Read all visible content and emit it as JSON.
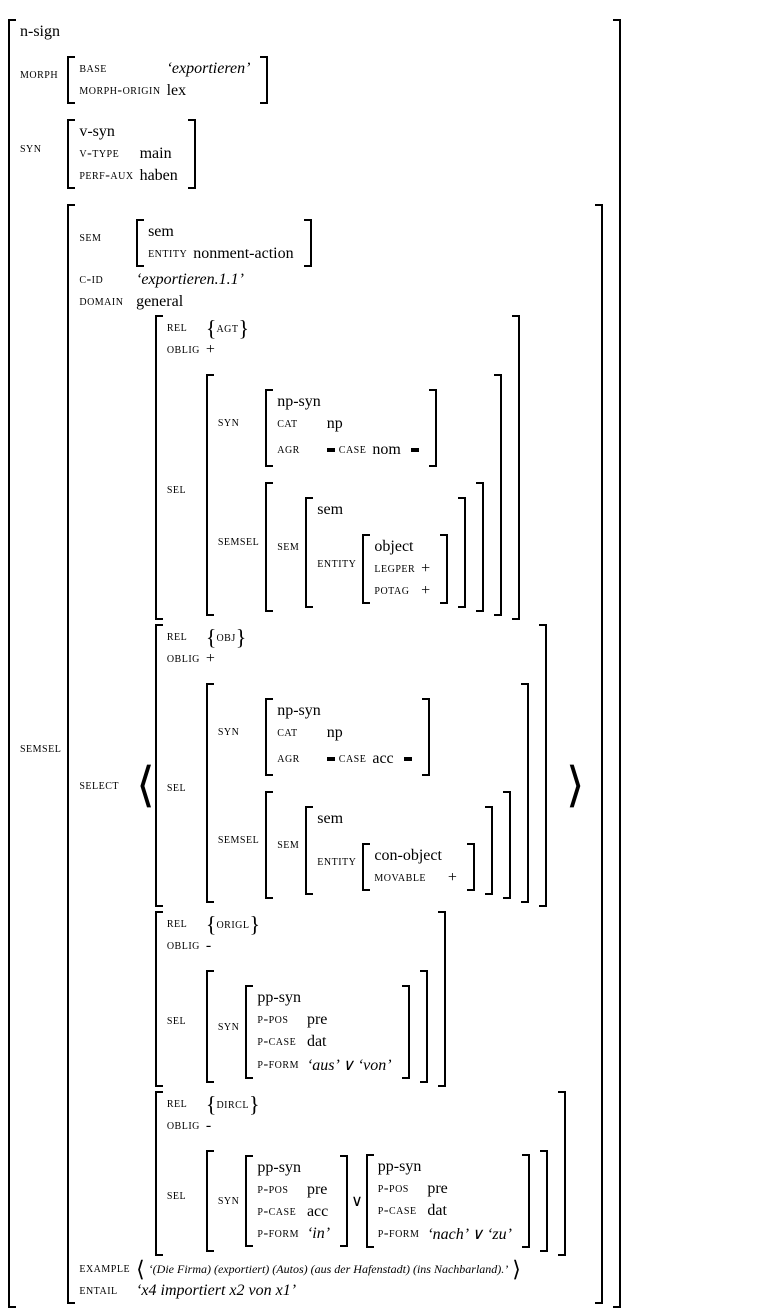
{
  "root_type": "n-sign",
  "morph": {
    "label": "morph",
    "base": {
      "k": "base",
      "v": "‘exportieren’"
    },
    "morph_origin": {
      "k": "morph-origin",
      "v": "lex"
    }
  },
  "syn": {
    "label": "syn",
    "type": "v-syn",
    "v_type": {
      "k": "v-type",
      "v": "main"
    },
    "perf_aux": {
      "k": "perf-aux",
      "v": "haben"
    }
  },
  "semsel": {
    "label": "semsel",
    "sem": {
      "k": "sem",
      "type": "sem",
      "entity": {
        "k": "entity",
        "v": "nonment-action"
      }
    },
    "c_id": {
      "k": "c-id",
      "v": "‘exportieren.1.1’"
    },
    "domain": {
      "k": "domain",
      "v": "general"
    },
    "select_label": "select",
    "example": {
      "k": "example",
      "v": "‘(Die Firma) (exportiert) (Autos) (aus der Hafenstadt) (ins Nachbarland).’"
    },
    "entail": {
      "k": "entail",
      "v": "‘x4 importiert x2 von x1’"
    }
  },
  "labels": {
    "rel": "rel",
    "oblig": "oblig",
    "sel": "sel",
    "syn": "syn",
    "semsel": "semsel",
    "sem": "sem",
    "entity": "entity",
    "cat": "cat",
    "agr": "agr",
    "case": "case",
    "p_pos": "p-pos",
    "p_case": "p-case",
    "p_form": "p-form",
    "legper": "legper",
    "potag": "potag",
    "movable": "movable"
  },
  "arg1": {
    "rel": "agt",
    "oblig": "+",
    "syn_type": "np-syn",
    "cat": "np",
    "case": "nom",
    "sem_type": "sem",
    "entity_type": "object",
    "legper": "+",
    "potag": "+"
  },
  "arg2": {
    "rel": "obj",
    "oblig": "+",
    "syn_type": "np-syn",
    "cat": "np",
    "case": "acc",
    "sem_type": "sem",
    "entity_type": "con-object",
    "movable": "+"
  },
  "arg3": {
    "rel": "origl",
    "oblig": "-",
    "syn_type": "pp-syn",
    "p_pos": "pre",
    "p_case": "dat",
    "p_form": "‘aus’ ∨ ‘von’"
  },
  "arg4": {
    "rel": "dircl",
    "oblig": "-",
    "a": {
      "syn_type": "pp-syn",
      "p_pos": "pre",
      "p_case": "acc",
      "p_form": "‘in’"
    },
    "b": {
      "syn_type": "pp-syn",
      "p_pos": "pre",
      "p_case": "dat",
      "p_form": "‘nach’ ∨ ‘zu’"
    }
  },
  "vee": "∨"
}
